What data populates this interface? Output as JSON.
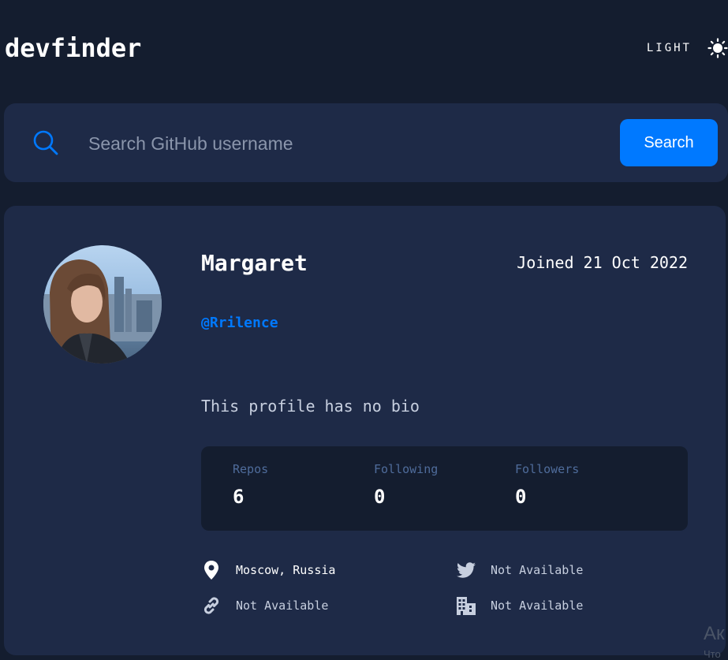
{
  "app": {
    "title": "devfinder"
  },
  "theme_toggle": {
    "label": "LIGHT",
    "icon": "sun-icon"
  },
  "search": {
    "placeholder": "Search GitHub username",
    "value": "",
    "button_label": "Search",
    "icon": "search-icon"
  },
  "profile": {
    "name": "Margaret",
    "joined": "Joined 21 Oct 2022",
    "login": "@Rrilence",
    "bio": "This profile has no bio",
    "avatar": "avatar-photo"
  },
  "stats": {
    "repos_label": "Repos",
    "repos_value": "6",
    "following_label": "Following",
    "following_value": "0",
    "followers_label": "Followers",
    "followers_value": "0"
  },
  "links": {
    "location": "Moscow, Russia",
    "twitter": "Not Available",
    "blog": "Not Available",
    "company": "Not Available"
  },
  "colors": {
    "background": "#141d2f",
    "card": "#1e2a47",
    "accent": "#0079ff",
    "stats_bg": "#141d2f",
    "stat_label": "#4f6c9b"
  },
  "watermark": {
    "line1": "Ак",
    "line2": "Что"
  }
}
